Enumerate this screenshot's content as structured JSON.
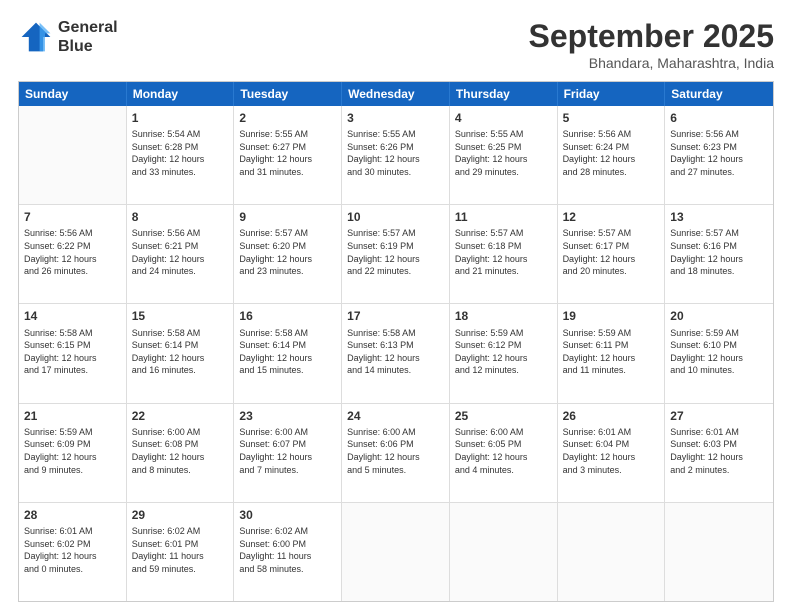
{
  "logo": {
    "line1": "General",
    "line2": "Blue"
  },
  "title": "September 2025",
  "location": "Bhandara, Maharashtra, India",
  "weekdays": [
    "Sunday",
    "Monday",
    "Tuesday",
    "Wednesday",
    "Thursday",
    "Friday",
    "Saturday"
  ],
  "weeks": [
    [
      {
        "day": "",
        "info": ""
      },
      {
        "day": "1",
        "info": "Sunrise: 5:54 AM\nSunset: 6:28 PM\nDaylight: 12 hours\nand 33 minutes."
      },
      {
        "day": "2",
        "info": "Sunrise: 5:55 AM\nSunset: 6:27 PM\nDaylight: 12 hours\nand 31 minutes."
      },
      {
        "day": "3",
        "info": "Sunrise: 5:55 AM\nSunset: 6:26 PM\nDaylight: 12 hours\nand 30 minutes."
      },
      {
        "day": "4",
        "info": "Sunrise: 5:55 AM\nSunset: 6:25 PM\nDaylight: 12 hours\nand 29 minutes."
      },
      {
        "day": "5",
        "info": "Sunrise: 5:56 AM\nSunset: 6:24 PM\nDaylight: 12 hours\nand 28 minutes."
      },
      {
        "day": "6",
        "info": "Sunrise: 5:56 AM\nSunset: 6:23 PM\nDaylight: 12 hours\nand 27 minutes."
      }
    ],
    [
      {
        "day": "7",
        "info": "Sunrise: 5:56 AM\nSunset: 6:22 PM\nDaylight: 12 hours\nand 26 minutes."
      },
      {
        "day": "8",
        "info": "Sunrise: 5:56 AM\nSunset: 6:21 PM\nDaylight: 12 hours\nand 24 minutes."
      },
      {
        "day": "9",
        "info": "Sunrise: 5:57 AM\nSunset: 6:20 PM\nDaylight: 12 hours\nand 23 minutes."
      },
      {
        "day": "10",
        "info": "Sunrise: 5:57 AM\nSunset: 6:19 PM\nDaylight: 12 hours\nand 22 minutes."
      },
      {
        "day": "11",
        "info": "Sunrise: 5:57 AM\nSunset: 6:18 PM\nDaylight: 12 hours\nand 21 minutes."
      },
      {
        "day": "12",
        "info": "Sunrise: 5:57 AM\nSunset: 6:17 PM\nDaylight: 12 hours\nand 20 minutes."
      },
      {
        "day": "13",
        "info": "Sunrise: 5:57 AM\nSunset: 6:16 PM\nDaylight: 12 hours\nand 18 minutes."
      }
    ],
    [
      {
        "day": "14",
        "info": "Sunrise: 5:58 AM\nSunset: 6:15 PM\nDaylight: 12 hours\nand 17 minutes."
      },
      {
        "day": "15",
        "info": "Sunrise: 5:58 AM\nSunset: 6:14 PM\nDaylight: 12 hours\nand 16 minutes."
      },
      {
        "day": "16",
        "info": "Sunrise: 5:58 AM\nSunset: 6:14 PM\nDaylight: 12 hours\nand 15 minutes."
      },
      {
        "day": "17",
        "info": "Sunrise: 5:58 AM\nSunset: 6:13 PM\nDaylight: 12 hours\nand 14 minutes."
      },
      {
        "day": "18",
        "info": "Sunrise: 5:59 AM\nSunset: 6:12 PM\nDaylight: 12 hours\nand 12 minutes."
      },
      {
        "day": "19",
        "info": "Sunrise: 5:59 AM\nSunset: 6:11 PM\nDaylight: 12 hours\nand 11 minutes."
      },
      {
        "day": "20",
        "info": "Sunrise: 5:59 AM\nSunset: 6:10 PM\nDaylight: 12 hours\nand 10 minutes."
      }
    ],
    [
      {
        "day": "21",
        "info": "Sunrise: 5:59 AM\nSunset: 6:09 PM\nDaylight: 12 hours\nand 9 minutes."
      },
      {
        "day": "22",
        "info": "Sunrise: 6:00 AM\nSunset: 6:08 PM\nDaylight: 12 hours\nand 8 minutes."
      },
      {
        "day": "23",
        "info": "Sunrise: 6:00 AM\nSunset: 6:07 PM\nDaylight: 12 hours\nand 7 minutes."
      },
      {
        "day": "24",
        "info": "Sunrise: 6:00 AM\nSunset: 6:06 PM\nDaylight: 12 hours\nand 5 minutes."
      },
      {
        "day": "25",
        "info": "Sunrise: 6:00 AM\nSunset: 6:05 PM\nDaylight: 12 hours\nand 4 minutes."
      },
      {
        "day": "26",
        "info": "Sunrise: 6:01 AM\nSunset: 6:04 PM\nDaylight: 12 hours\nand 3 minutes."
      },
      {
        "day": "27",
        "info": "Sunrise: 6:01 AM\nSunset: 6:03 PM\nDaylight: 12 hours\nand 2 minutes."
      }
    ],
    [
      {
        "day": "28",
        "info": "Sunrise: 6:01 AM\nSunset: 6:02 PM\nDaylight: 12 hours\nand 0 minutes."
      },
      {
        "day": "29",
        "info": "Sunrise: 6:02 AM\nSunset: 6:01 PM\nDaylight: 11 hours\nand 59 minutes."
      },
      {
        "day": "30",
        "info": "Sunrise: 6:02 AM\nSunset: 6:00 PM\nDaylight: 11 hours\nand 58 minutes."
      },
      {
        "day": "",
        "info": ""
      },
      {
        "day": "",
        "info": ""
      },
      {
        "day": "",
        "info": ""
      },
      {
        "day": "",
        "info": ""
      }
    ]
  ]
}
